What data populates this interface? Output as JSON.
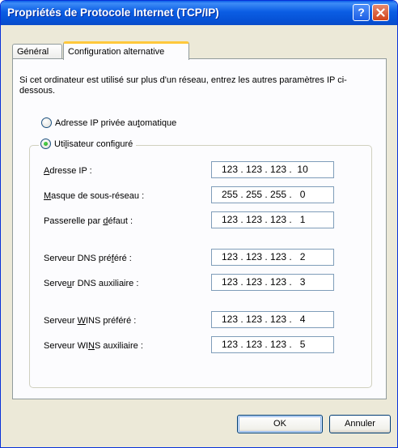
{
  "window": {
    "title": "Propriétés de Protocole Internet (TCP/IP)"
  },
  "tabs": [
    {
      "label": "Général",
      "active": false
    },
    {
      "label": "Configuration alternative",
      "active": true
    }
  ],
  "intro_text": "Si cet ordinateur est utilisé sur plus d'un réseau, entrez les autres paramètres IP ci-dessous.",
  "radios": [
    {
      "label": "Adresse IP privée automatique",
      "selected": false
    },
    {
      "label": "Utilisateur configuré",
      "selected": true
    }
  ],
  "fields": [
    {
      "label": "Adresse IP :",
      "value": "123 . 123 . 123 .  10"
    },
    {
      "label": "Masque de sous-réseau :",
      "value": "255 . 255 . 255 .   0"
    },
    {
      "label": "Passerelle par défaut :",
      "value": "123 . 123 . 123 .   1"
    },
    {
      "label": "Serveur DNS préféré :",
      "value": "123 . 123 . 123 .   2"
    },
    {
      "label": "Serveur DNS auxiliaire :",
      "value": "123 . 123 . 123 .   3"
    },
    {
      "label": "Serveur WINS préféré :",
      "value": "123 . 123 . 123 .   4"
    },
    {
      "label": "Serveur WINS auxiliaire :",
      "value": "123 . 123 . 123 .   5"
    }
  ],
  "buttons": {
    "ok": "OK",
    "cancel": "Annuler"
  },
  "colors": {
    "titlebar": "#0a5fe8",
    "dialog_bg": "#ece9d8",
    "active_tab_accent": "#ffc83c"
  }
}
